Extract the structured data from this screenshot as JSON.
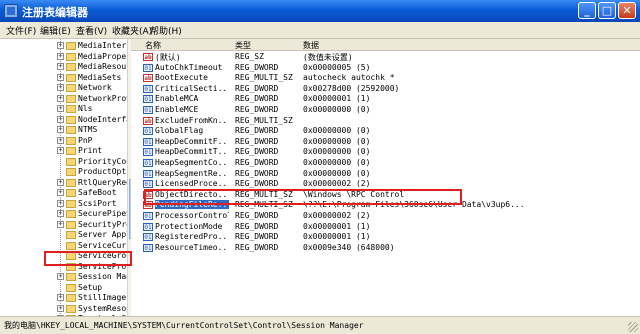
{
  "window": {
    "title": "注册表编辑器"
  },
  "titlebar_buttons": {
    "min": "_",
    "max": "□",
    "close": "✕"
  },
  "menu": [
    "文件(F)",
    "编辑(E)",
    "查看(V)",
    "收藏夹(A)",
    "帮助(H)"
  ],
  "tree": {
    "items": [
      {
        "label": "MediaInterfac",
        "expander": "+"
      },
      {
        "label": "MediaProperti",
        "expander": "+"
      },
      {
        "label": "MediaResource",
        "expander": "+"
      },
      {
        "label": "MediaSets",
        "expander": "+"
      },
      {
        "label": "Network",
        "expander": "+"
      },
      {
        "label": "NetworkProvid",
        "expander": "+"
      },
      {
        "label": "Nls",
        "expander": "+"
      },
      {
        "label": "NodeInterface",
        "expander": "+"
      },
      {
        "label": "NTMS",
        "expander": "+"
      },
      {
        "label": "PnP",
        "expander": "+"
      },
      {
        "label": "Print",
        "expander": "+"
      },
      {
        "label": "PriorityContr",
        "expander": ""
      },
      {
        "label": "ProductOption",
        "expander": ""
      },
      {
        "label": "RtlQueryRegis",
        "expander": "+"
      },
      {
        "label": "SafeBoot",
        "expander": "+"
      },
      {
        "label": "ScsiPort",
        "expander": "+"
      },
      {
        "label": "SecurePipeSer",
        "expander": "+"
      },
      {
        "label": "SecurityProvi",
        "expander": "+"
      },
      {
        "label": "Server Applic",
        "expander": ""
      },
      {
        "label": "ServiceCurren",
        "expander": ""
      },
      {
        "label": "ServiceGroupO",
        "expander": ""
      },
      {
        "label": "ServiceProvid",
        "expander": ""
      },
      {
        "label": "Session Manag",
        "expander": "+"
      },
      {
        "label": "Setup",
        "expander": ""
      },
      {
        "label": "StillImage",
        "expander": "+"
      },
      {
        "label": "SystemResourc",
        "expander": "+"
      },
      {
        "label": "Terminal Serv",
        "expander": "+"
      }
    ]
  },
  "list": {
    "headers": {
      "name": "名称",
      "type": "类型",
      "data": "数据"
    },
    "rows": [
      {
        "icon": "ab",
        "name": "(默认)",
        "type": "REG_SZ",
        "data": "(数值未设置)"
      },
      {
        "icon": "bin",
        "name": "AutoChkTimeout",
        "type": "REG_DWORD",
        "data": "0x00000005 (5)"
      },
      {
        "icon": "ab",
        "name": "BootExecute",
        "type": "REG_MULTI_SZ",
        "data": "autocheck autochk *"
      },
      {
        "icon": "bin",
        "name": "CriticalSecti...",
        "type": "REG_DWORD",
        "data": "0x00278d00 (2592000)"
      },
      {
        "icon": "bin",
        "name": "EnableMCA",
        "type": "REG_DWORD",
        "data": "0x00000001 (1)"
      },
      {
        "icon": "bin",
        "name": "EnableMCE",
        "type": "REG_DWORD",
        "data": "0x00000000 (0)"
      },
      {
        "icon": "ab",
        "name": "ExcludeFromKn...",
        "type": "REG_MULTI_SZ",
        "data": ""
      },
      {
        "icon": "bin",
        "name": "GlobalFlag",
        "type": "REG_DWORD",
        "data": "0x00000000 (0)"
      },
      {
        "icon": "bin",
        "name": "HeapDeCommitF...",
        "type": "REG_DWORD",
        "data": "0x00000000 (0)"
      },
      {
        "icon": "bin",
        "name": "HeapDeCommitT...",
        "type": "REG_DWORD",
        "data": "0x00000000 (0)"
      },
      {
        "icon": "bin",
        "name": "HeapSegmentCo...",
        "type": "REG_DWORD",
        "data": "0x00000000 (0)"
      },
      {
        "icon": "bin",
        "name": "HeapSegmentRe...",
        "type": "REG_DWORD",
        "data": "0x00000000 (0)"
      },
      {
        "icon": "bin",
        "name": "LicensedProce...",
        "type": "REG_DWORD",
        "data": "0x00000002 (2)"
      },
      {
        "icon": "ab",
        "name": "ObjectDirecto...",
        "type": "REG_MULTI_SZ",
        "data": "\\Windows \\RPC Control"
      },
      {
        "icon": "ab",
        "name": "PendingFileRe...",
        "type": "REG_MULTI_SZ",
        "data": "\\??\\E:\\Program Files\\360se6\\User Data\\v3up6..."
      },
      {
        "icon": "bin",
        "name": "ProcessorControl",
        "type": "REG_DWORD",
        "data": "0x00000002 (2)"
      },
      {
        "icon": "bin",
        "name": "ProtectionMode",
        "type": "REG_DWORD",
        "data": "0x00000001 (1)"
      },
      {
        "icon": "bin",
        "name": "RegisteredPro...",
        "type": "REG_DWORD",
        "data": "0x00000001 (1)"
      },
      {
        "icon": "bin",
        "name": "ResourceTimeo...",
        "type": "REG_DWORD",
        "data": "0x0009e340 (648000)"
      }
    ]
  },
  "status": {
    "path": "我的电脑\\HKEY_LOCAL_MACHINE\\SYSTEM\\CurrentControlSet\\Control\\Session Manager"
  },
  "colors": {
    "highlight_box": "#e02020",
    "selection": "#316ac5",
    "titlebar": "#0a5bd6"
  }
}
